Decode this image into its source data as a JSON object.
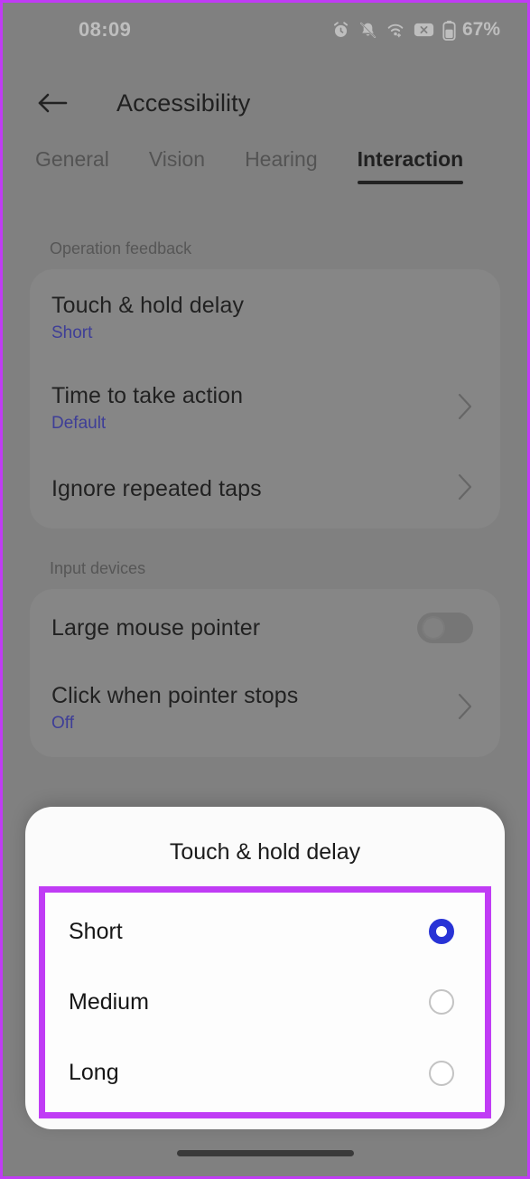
{
  "status_bar": {
    "clock": "08:09",
    "battery_percent": "67%",
    "icons": [
      "alarm-icon",
      "bell-muted-icon",
      "wifi-icon",
      "no-sim-icon",
      "battery-icon"
    ]
  },
  "app_bar": {
    "back_icon": "back-arrow-icon",
    "title": "Accessibility"
  },
  "tabs": [
    {
      "label": "General",
      "active": false
    },
    {
      "label": "Vision",
      "active": false
    },
    {
      "label": "Hearing",
      "active": false
    },
    {
      "label": "Interaction",
      "active": true
    }
  ],
  "sections": [
    {
      "label": "Operation feedback",
      "rows": [
        {
          "title": "Touch & hold delay",
          "subtitle": "Short",
          "control": "none"
        },
        {
          "title": "Time to take action",
          "subtitle": "Default",
          "control": "chevron"
        },
        {
          "title": "Ignore repeated taps",
          "subtitle": "",
          "control": "chevron"
        }
      ]
    },
    {
      "label": "Input devices",
      "rows": [
        {
          "title": "Large mouse pointer",
          "subtitle": "",
          "control": "toggle-off"
        },
        {
          "title": "Click when pointer stops",
          "subtitle": "Off",
          "control": "chevron"
        }
      ]
    }
  ],
  "dialog": {
    "title": "Touch & hold delay",
    "options": [
      {
        "label": "Short",
        "selected": true
      },
      {
        "label": "Medium",
        "selected": false
      },
      {
        "label": "Long",
        "selected": false
      }
    ]
  },
  "colors": {
    "annotation_purple": "#c03cf5",
    "selected_radio_blue": "#2833d6",
    "subtitle_blue": "#3b3bbb",
    "dimmed_background": "#9a9a9a",
    "sheet_background": "#fbfbfb"
  },
  "nav": {
    "handle": "home-gesture-handle"
  }
}
